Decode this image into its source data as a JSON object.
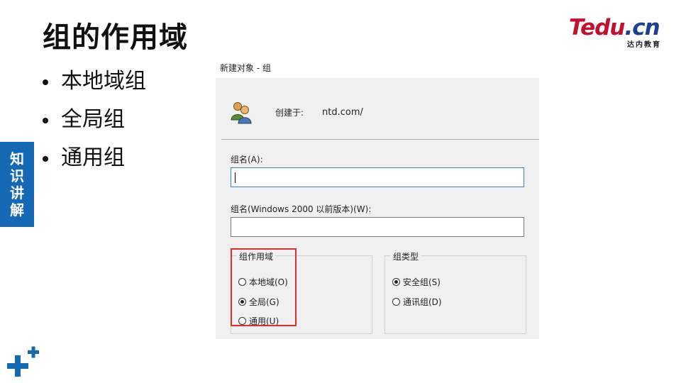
{
  "slide": {
    "title": "组的作用域",
    "bullets": [
      "本地域组",
      "全局组",
      "通用组"
    ],
    "side_tab": [
      "知",
      "识",
      "讲",
      "解"
    ]
  },
  "logo": {
    "brand_main": "Tedu",
    "brand_suffix": ".cn",
    "tagline": "达内教育"
  },
  "dialog": {
    "caption": "新建对象 - 组",
    "created_in_label": "创建于:",
    "created_in_value": "ntd.com/",
    "group_name_label": "组名(A):",
    "group_name_value": "",
    "group_name_pre2000_label": "组名(Windows 2000 以前版本)(W):",
    "group_name_pre2000_value": "",
    "scope": {
      "legend": "组作用域",
      "options": [
        {
          "label": "本地域(O)",
          "checked": false
        },
        {
          "label": "全局(G)",
          "checked": true
        },
        {
          "label": "通用(U)",
          "checked": false
        }
      ]
    },
    "type": {
      "legend": "组类型",
      "options": [
        {
          "label": "安全组(S)",
          "checked": true
        },
        {
          "label": "通讯组(D)",
          "checked": false
        }
      ]
    }
  },
  "colors": {
    "accent_red": "#e0302e",
    "side_tab_blue": "#1468b4",
    "logo_red": "#c3102e",
    "logo_blue": "#1c3f8f"
  },
  "icons": {
    "users": "users-group-icon",
    "decor": "plus-decoration-icon"
  }
}
